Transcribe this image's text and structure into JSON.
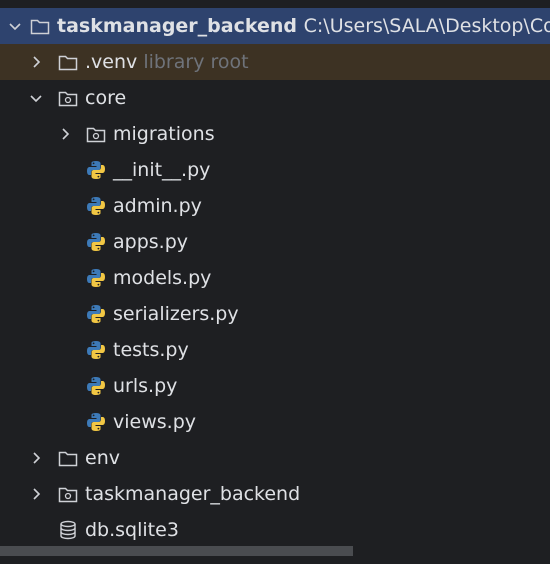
{
  "project": {
    "root_name": "taskmanager_backend",
    "root_path": "C:\\Users\\SALA\\Desktop\\Con"
  },
  "items": [
    {
      "label": "taskmanager_backend",
      "hint": "",
      "type": "folder"
    },
    {
      "label": ".venv",
      "hint": "library root",
      "type": "folder"
    },
    {
      "label": "core",
      "hint": "",
      "type": "package"
    },
    {
      "label": "migrations",
      "hint": "",
      "type": "package"
    },
    {
      "label": "__init__.py",
      "hint": "",
      "type": "python"
    },
    {
      "label": "admin.py",
      "hint": "",
      "type": "python"
    },
    {
      "label": "apps.py",
      "hint": "",
      "type": "python"
    },
    {
      "label": "models.py",
      "hint": "",
      "type": "python"
    },
    {
      "label": "serializers.py",
      "hint": "",
      "type": "python"
    },
    {
      "label": "tests.py",
      "hint": "",
      "type": "python"
    },
    {
      "label": "urls.py",
      "hint": "",
      "type": "python"
    },
    {
      "label": "views.py",
      "hint": "",
      "type": "python"
    },
    {
      "label": "env",
      "hint": "",
      "type": "folder"
    },
    {
      "label": "taskmanager_backend",
      "hint": "",
      "type": "package"
    },
    {
      "label": "db.sqlite3",
      "hint": "",
      "type": "database"
    }
  ],
  "colors": {
    "background": "#1e1f22",
    "selection": "#2e436e",
    "library_root_highlight": "#3d3223",
    "text": "#dfe1e5",
    "hint_text": "#6f737a",
    "python_blue": "#3d7ab8",
    "python_yellow": "#f2c744"
  }
}
